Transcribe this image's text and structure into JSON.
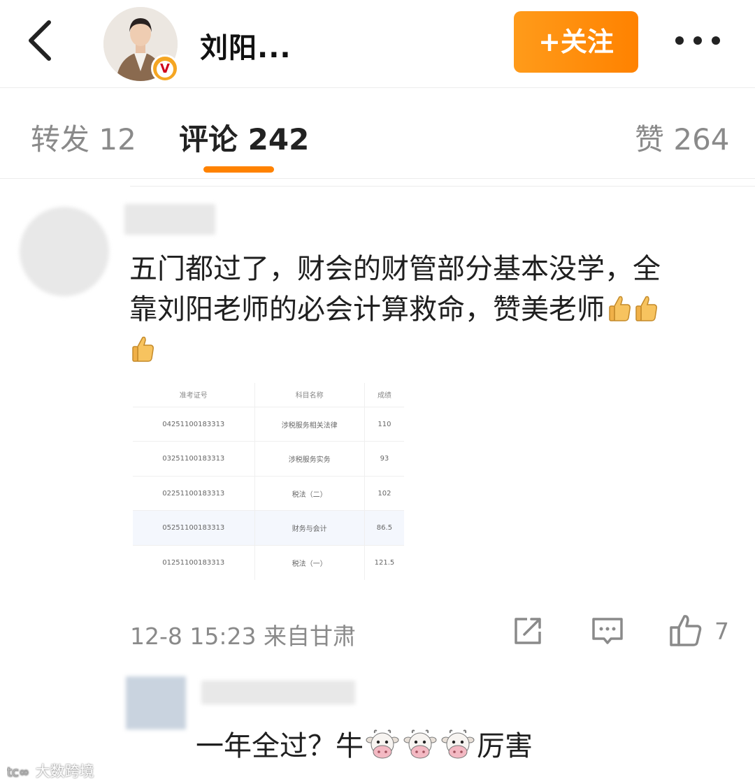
{
  "header": {
    "username": "刘阳...",
    "follow_label": "+关注",
    "verified_badge": "V"
  },
  "tabs": [
    {
      "label": "转发 12"
    },
    {
      "label": "评论 242"
    },
    {
      "label": "赞 264"
    }
  ],
  "comment": {
    "text_line1": "五门都过了，财会的财管部分基本没学，全",
    "text_line2": "靠刘阳老师的必会计算救命，赞美老师",
    "emoji": "thumbs-up-icon",
    "score_table": {
      "headers": [
        "准考证号",
        "科目名称",
        "成绩"
      ],
      "rows": [
        [
          "04251100183313",
          "涉税服务相关法律",
          "110"
        ],
        [
          "03251100183313",
          "涉税服务实务",
          "93"
        ],
        [
          "02251100183313",
          "税法（二）",
          "102"
        ],
        [
          "05251100183313",
          "财务与会计",
          "86.5"
        ],
        [
          "01251100183313",
          "税法（一）",
          "121.5"
        ]
      ]
    },
    "time": "12-8 15:23",
    "location": "来自甘肃",
    "like_count": "7"
  },
  "reply": {
    "text_before": "一年全过？牛",
    "text_after": "厉害",
    "emoji": "cow-face-icon"
  },
  "watermark": "大数跨境",
  "colors": {
    "accent": "#ff8200",
    "muted_text": "#8a8a8a",
    "primary_text": "#1f1f1f"
  }
}
